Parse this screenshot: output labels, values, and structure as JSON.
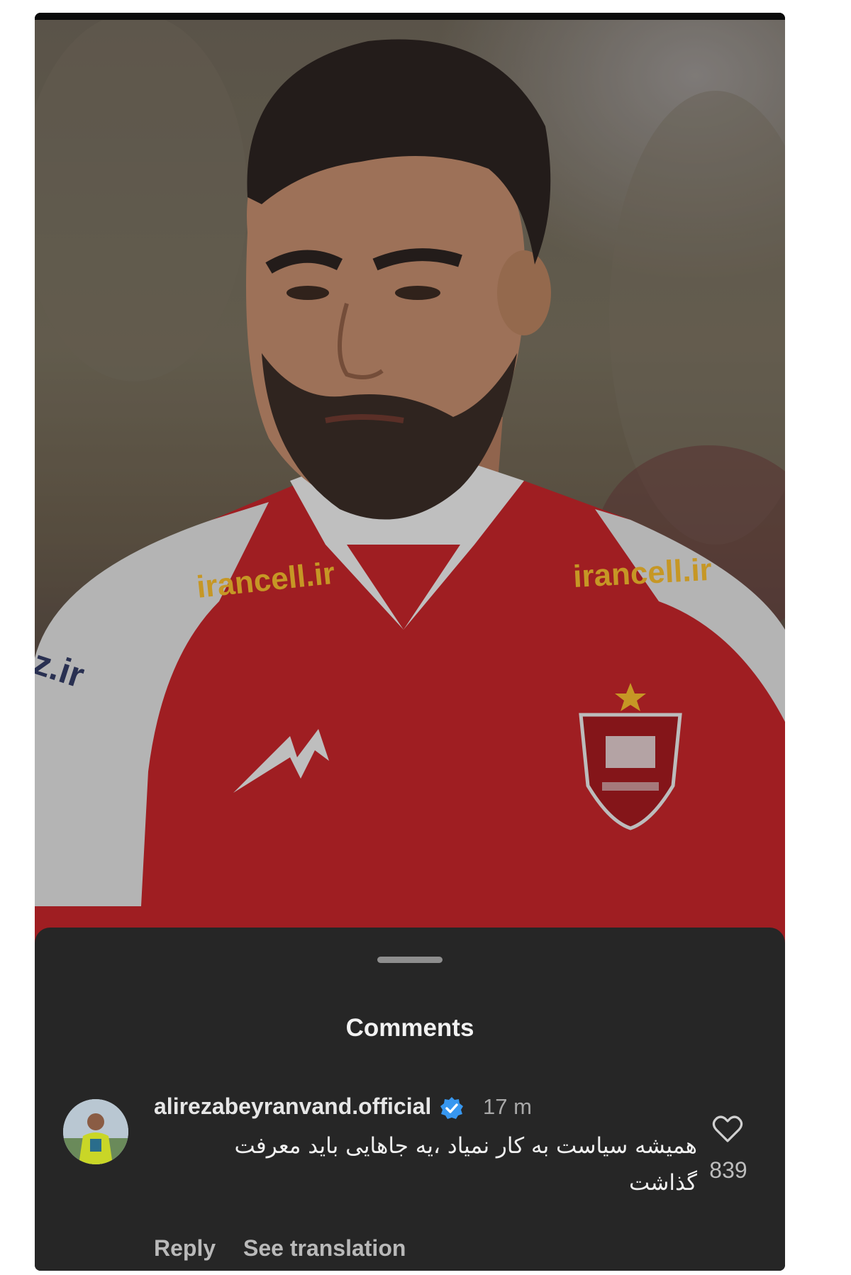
{
  "colors": {
    "sheet_background": "#262626",
    "jersey_red": "#c3252a",
    "sponsor_gold": "#f2b92e",
    "verified_blue": "#3797f0"
  },
  "post": {
    "image_subject": "football-player-portrait",
    "jersey_sponsor_left": "irancell.ir",
    "jersey_sponsor_right": "irancell.ir",
    "sleeve_text": "z.ir",
    "crest": "club-crest-icon"
  },
  "comments_sheet": {
    "title": "Comments",
    "comment": {
      "username": "alirezabeyranvand.official",
      "verified": "verified-badge-icon",
      "time": "17 m",
      "text": "همیشه سیاست به کار نمیاد ،یه جاهایی باید معرفت گذاشت",
      "likes": "839",
      "like_icon": "heart-icon",
      "reply_label": "Reply",
      "translate_label": "See translation"
    }
  }
}
